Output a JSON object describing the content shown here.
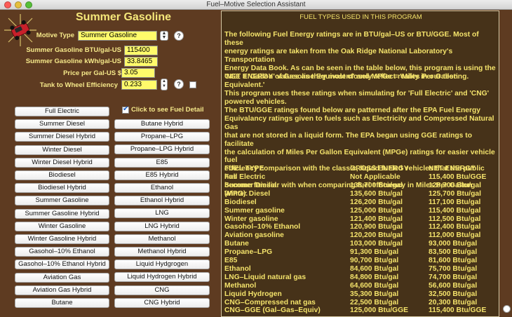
{
  "window": {
    "title": "Fuel–Motive Selection Assistant"
  },
  "panel": {
    "heading": "Summer Gasoline",
    "motive_type_label": "Motive Type",
    "motive_type_value": "Summer Gasoline",
    "btu_label": "Summer Gasoline BTU/gal-US",
    "btu_value": "115400",
    "kwh_label": "Summer Gasoline kWh/gal-US",
    "kwh_value": "33.8465",
    "price_label": "Price per Gal-US $",
    "price_value": "3.05",
    "efficiency_label": "Tank to Wheel Efficiency",
    "efficiency_value": "0.233",
    "help_glyph": "?",
    "detail_checkbox_label": "Click to see Fuel Detail",
    "detail_checked": true
  },
  "fuel_buttons_left": [
    "Full Electric",
    "Summer Diesel",
    "Summer Diesel Hybrid",
    "Winter Diesel",
    "Winter Diesel Hybrid",
    "Biodiesel",
    "Biodiesel Hybrid",
    "Summer Gasoline",
    "Summer Gasoline Hybrid",
    "Winter Gasoline",
    "Winter Gasoline Hybrid",
    "Gasohol–10% Ethanol",
    "Gasohol–10% Ethanol Hybrid",
    "Aviation Gas",
    "Aviation Gas Hybrid",
    "Butane"
  ],
  "fuel_buttons_right": [
    "Butane Hybrid",
    "Propane–LPG",
    "Propane–LPG Hybrid",
    "E85",
    "E85 Hybrid",
    "Ethanol",
    "Ethanol Hybrid",
    "LNG",
    "LNG Hybrid",
    "Methanol",
    "Methanol Hybrid",
    "Liquid Hydgrogen",
    "Liquid Hydrogen Hybrid",
    "CNG",
    "CNG Hybrid"
  ],
  "info": {
    "heading": "FUEL TYPES USED IN THIS PROGRAM",
    "para1": "The following Fuel Energy ratings are in BTU/gal–US or BTU/GGE.  Most of these\nenergy ratings are taken from the Oak Ridge National Laboratory's Transportation\nEnergy Data Book.  As can be seen in the table below, this program is using the\n'NET ENERGY' values as they most closely reflect reality in our testing.",
    "para2": "GGE = 'Gallon of Gasoline Equivalent' and MPGe = 'Miles Per Gallon Equivalent.'\nThis program uses these ratings when simulating for 'Full Electric' and 'CNG'\npowered vehicles.",
    "para3": "The BTU/GGE ratings found below are patterned after the EPA Fuel Energy\nEquivalancy ratings given to fuels such as Electricity and Compressed Natural Gas\nthat are not stored in a liquid form.  The EPA began using GGE ratings to facilitate\nthe calculation of Miles Per Gallon Equivalent (MPGe) ratings for easier vehicle fuel\nefficiency comparison with the classic, liquid fueled vehicles that the public has\nbecome familiar with when comparing fuel efficiency in Miles Per Gallon (MPG).",
    "table_headers": [
      "FUEL TYPE",
      "GROSS ENERGY",
      "NET ENERGY"
    ],
    "table_rows": [
      [
        "Full Electric",
        "Not Applicable",
        "115,400 Btu/GGE"
      ],
      [
        "Summer Diesel",
        "138,700 Btu/gal",
        "128,700 Btu/gal"
      ],
      [
        "Winter Diesel",
        "135,600 Btu/gal",
        "125,700 Btu/gal"
      ],
      [
        "Biodiesel",
        "126,200 Btu/gal",
        "117,100 Btu/gal"
      ],
      [
        "Summer gasoline",
        "125,000 Btu/gal",
        "115,400 Btu/gal"
      ],
      [
        "Winter gasoline",
        "121,400 Btu/gal",
        "112,500 Btu/gal"
      ],
      [
        "Gasohol–10% Ethanol",
        "120,900 Btu/gal",
        "112,400 Btu/gal"
      ],
      [
        "Aviation gasoline",
        "120,200 Btu/gal",
        "112,000 Btu/gal"
      ],
      [
        "Butane",
        "103,000 Btu/gal",
        "93,000 Btu/gal"
      ],
      [
        "Propane–LPG",
        "91,300 Btu/gal",
        "83,500 Btu/gal"
      ],
      [
        "E85",
        "90,700 Btu/gal",
        "81,600 Btu/gal"
      ],
      [
        "Ethanol",
        "84,600 Btu/gal",
        "75,700 Btu/gal"
      ],
      [
        "LNG–Liquid natural gas",
        "84,800 Btu/gal",
        "74,700 Btu/gal"
      ],
      [
        "Methanol",
        "64,600 Btu/gal",
        "56,600 Btu/gal"
      ],
      [
        "Liquid Hydrogen",
        "35,300 Btu/gal",
        "32,500 Btu/gal"
      ],
      [
        "CNG–Compressed nat gas",
        "22,500 Btu/gal",
        "20,300 Btu/gal"
      ],
      [
        "CNG–GGE (Gal–Gas–Equiv)",
        "125,000 Btu/GGE",
        "115,400 Btu/GGE"
      ]
    ]
  }
}
